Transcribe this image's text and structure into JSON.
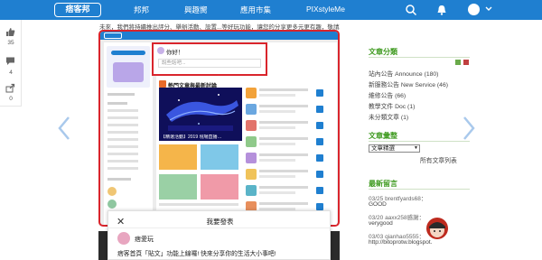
{
  "topbar": {
    "logo": "痞客邦",
    "nav": [
      "邦邦",
      "興趣嚮",
      "應用市集",
      "PIXstyleMe"
    ],
    "icons": [
      "search-icon",
      "bell-icon",
      "chevron-down-icon"
    ]
  },
  "leftbar": {
    "like_count": "35",
    "comment_count": "4",
    "share_count": "0"
  },
  "main": {
    "intro": "未來，我們將持續推出評分、舉辦活動、設置...等好玩功能，讓您的分享更多元更有趣，敬請期待！",
    "screenshot": {
      "logo": "痞客邦",
      "popup_title": "你好！",
      "popup_placeholder": "說些話吧...",
      "hot_title": "熱門文章與最新討論",
      "banner_caption": "【精選活動】2019 現場直播…"
    },
    "modal": {
      "close": "✕",
      "title": "我要發表",
      "user": "痞愛玩",
      "text": "痞客首頁「貼文」功能上線囉! 快來分享你的生活大小事吧!"
    }
  },
  "sidebar": {
    "categories_title": "文章分類",
    "categories": [
      "站內公告 Announce (180)",
      "新服務公告 New Service (46)",
      "維修公告 (66)",
      "教學文件 Doc (1)",
      "未分類文章 (1)"
    ],
    "archive_title": "文章彙整",
    "archive_select": "文章精選",
    "archive_all": "所有文章列表",
    "comments_title": "最新留言",
    "comments": [
      {
        "meta": "03/25 brentfyards68：",
        "text": "GOOD"
      },
      {
        "meta": "03/20 aaxx258感謝：",
        "text": "verygood"
      },
      {
        "meta": "03/03 qianhao5555：",
        "text": "http://bitoprotw.blogspot."
      }
    ]
  },
  "colors": {
    "brand_blue": "#1f7fd0",
    "highlight_red": "#d9252c",
    "sidebar_green": "#3e9a1f"
  }
}
